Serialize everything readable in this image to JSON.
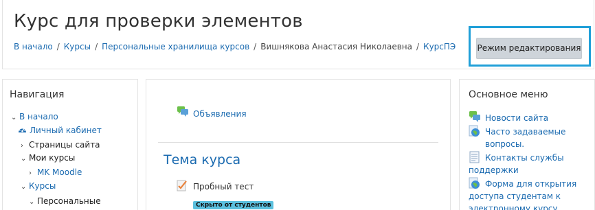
{
  "header": {
    "title": "Курс для проверки элементов",
    "breadcrumb": {
      "home": "В начало",
      "courses": "Курсы",
      "personal": "Персональные хранилища курсов",
      "person": "Вишнякова Анастасия Николаевна",
      "course": "КурсПЭ"
    },
    "edit_button": "Режим редактирования"
  },
  "navigation": {
    "title": "Навигация",
    "items": [
      {
        "label": "В начало"
      },
      {
        "label": "Личный кабинет"
      },
      {
        "label": "Страницы сайта"
      },
      {
        "label": "Мои курсы"
      },
      {
        "label": "MK Moodle"
      },
      {
        "label": "Курсы"
      },
      {
        "label": "Персональные"
      }
    ]
  },
  "main": {
    "forum_link": "Объявления",
    "section_title": "Тема курса",
    "quiz_label": "Пробный тест",
    "hidden_badge": "Скрыто от студентов"
  },
  "main_menu": {
    "title": "Основное меню",
    "items": [
      {
        "label": "Новости сайта"
      },
      {
        "label": "Часто задаваемые вопросы."
      },
      {
        "label": "Контакты службы поддержки"
      },
      {
        "label": "Форма для открытия доступа студентам к электронному курсу"
      }
    ]
  },
  "colors": {
    "link": "#1a6ab0",
    "highlight": "#1f9fd8",
    "button_bg": "#ced4da",
    "badge_bg": "#5bc0de"
  },
  "icons": [
    "forum-icon",
    "dashboard-icon",
    "quiz-icon",
    "page-icon",
    "globe-icon"
  ]
}
